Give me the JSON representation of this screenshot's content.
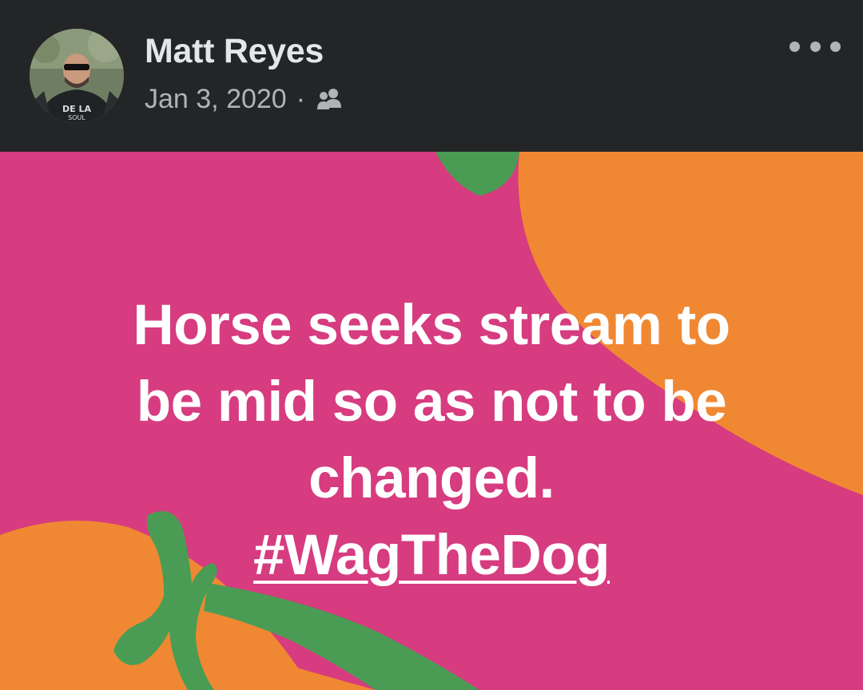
{
  "post": {
    "author_name": "Matt Reyes",
    "date": "Jan 3, 2020",
    "separator": "·",
    "audience_icon": "friends-icon",
    "more_icon": "more-options-icon",
    "text_line1": "Horse seeks stream to",
    "text_line2": "be mid so as not to be",
    "text_line3": "changed.",
    "hashtag": "#WagTheDog",
    "avatar_shirt_text": "DE LA SOUL"
  },
  "colors": {
    "header_bg": "#242526",
    "background_pink": "#d63c7f",
    "accent_orange": "#f08833",
    "leaf_green": "#4a9c55",
    "text_white": "#ffffff",
    "meta_gray": "#b0b3b8"
  }
}
